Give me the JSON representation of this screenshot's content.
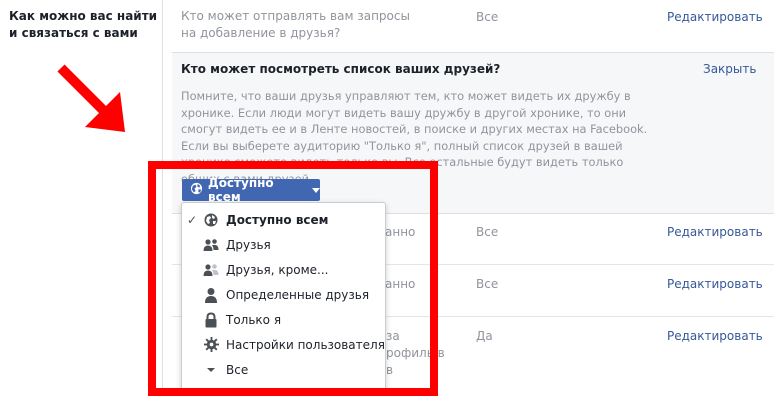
{
  "section": {
    "label": "Как можно вас найти и связаться с вами"
  },
  "row1": {
    "question": "Кто может отправлять вам запросы на добавление в друзья?",
    "value": "Все",
    "edit": "Редактировать"
  },
  "panel": {
    "title": "Кто может посмотреть список ваших друзей?",
    "close": "Закрыть",
    "description": "Помните, что ваши друзья управляют тем, кто может видеть их дружбу в хронике. Если люди могут видеть вашу дружбу в другой хронике, то они смогут видеть ее и в Ленте новостей, в поиске и других местах на Facebook. Если вы выберете аудиторию \"Только я\", полный список друзей в вашей хронике сможете видеть только вы. Все остальные будут видеть только общих с вами друзей.",
    "audience_button": "Доступно всем"
  },
  "menu": {
    "items": [
      {
        "label": "Доступно всем",
        "icon": "globe-icon",
        "selected": true
      },
      {
        "label": "Друзья",
        "icon": "friends-icon",
        "selected": false
      },
      {
        "label": "Друзья, кроме...",
        "icon": "friends-except-icon",
        "selected": false
      },
      {
        "label": "Определенные друзья",
        "icon": "person-icon",
        "selected": false
      },
      {
        "label": "Только я",
        "icon": "lock-icon",
        "selected": false
      },
      {
        "label": "Настройки пользователя",
        "icon": "gear-icon",
        "selected": false
      },
      {
        "label": "Все",
        "icon": "chevron-down-icon",
        "selected": false
      }
    ]
  },
  "rows_below": [
    {
      "partial": "анно",
      "value": "Все",
      "edit": "Редактировать"
    },
    {
      "partial": "анно",
      "value": "Все",
      "edit": "Редактировать"
    },
    {
      "partial_lines": [
        "за",
        "рофиль в"
      ],
      "value": "Да",
      "edit": "Редактировать"
    }
  ],
  "colors": {
    "accent": "#4267b2",
    "link": "#365899",
    "annotation": "#ff0000"
  }
}
